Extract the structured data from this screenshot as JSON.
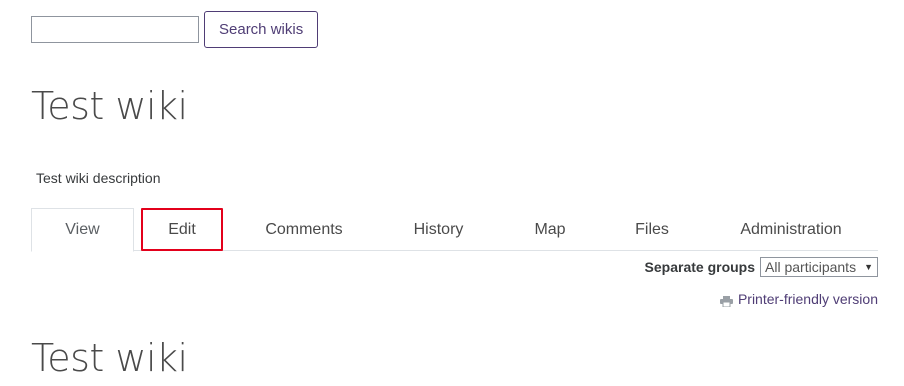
{
  "search": {
    "value": "",
    "placeholder": "",
    "button_label": "Search wikis"
  },
  "page": {
    "title": "Test wiki",
    "description": "Test wiki description"
  },
  "tabs": [
    {
      "label": "View",
      "active": true
    },
    {
      "label": "Edit",
      "highlighted": true
    },
    {
      "label": "Comments"
    },
    {
      "label": "History"
    },
    {
      "label": "Map"
    },
    {
      "label": "Files"
    },
    {
      "label": "Administration"
    }
  ],
  "groups": {
    "label": "Separate groups",
    "selected": "All participants"
  },
  "printer": {
    "icon": "printer-icon",
    "label": "Printer-friendly version"
  },
  "content": {
    "title": "Test wiki"
  },
  "colors": {
    "brand": "#4f3d75",
    "highlight": "#e3001b",
    "border": "#dee2e6"
  }
}
